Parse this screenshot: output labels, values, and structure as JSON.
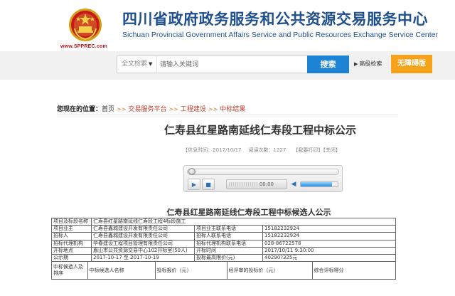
{
  "header": {
    "title_cn": "四川省政府政务服务和公共资源交易服务中心",
    "title_en": "Sichuan Provincial Government Affairs Service and Public Resources Exchange Service Center",
    "url": "www.SPPREC.com",
    "emblem_icon": "national-emblem-icon"
  },
  "search": {
    "scope_label": "全文检索",
    "scope_arrow": "▼",
    "placeholder": "请输入关键词",
    "button_label": "搜索",
    "advanced_label": "高级检索",
    "no_process_label": "无障碍版"
  },
  "breadcrumb": {
    "prefix": "您现在的位置：",
    "home": "首页",
    "sep": ">>",
    "items": [
      "交易服务平台",
      "工程建设",
      "中标结果"
    ]
  },
  "article": {
    "title": "仁寿县红星路南延线仁寿段工程中标公示",
    "meta_info_time": "【信息时间：2017/10/17",
    "meta_views": "阅读次数：1227",
    "meta_print": "【我要打印】【关闭】"
  },
  "player": {
    "time": "00:00",
    "play_icon": "play-icon",
    "stop_icon": "stop-icon",
    "volume_icon": "volume-icon",
    "progress_fraction": 0.0,
    "volume_fraction": 0.85
  },
  "table": {
    "title": "仁寿县红星路南延线仁寿段工程中标候选人公示",
    "rows": [
      [
        "项目及标段名称",
        "仁寿县红星路南延线仁寿段工程4标段施工",
        "",
        ""
      ],
      [
        "项目业主",
        "仁寿县鑫城建设开发有限责任公司",
        "项目业主联系电话",
        "15182232924"
      ],
      [
        "招标人",
        "仁寿县鑫城建设开发有限责任公司",
        "招标人联系电话",
        "15182232924"
      ],
      [
        "招标代理机构",
        "华春建设工程项目管理有限责任公司",
        "招标代理机构联系电话",
        "028-86722578"
      ],
      [
        "开标地点",
        "眉山市公共资源交易中心102开标室(50人)",
        "开标时间",
        "2017/10/11 9:30:00"
      ],
      [
        "公示期",
        "2017-10-17 至 2017-10-19",
        "投标最高限价(元)",
        "40290?325元"
      ]
    ],
    "header_row": [
      "中标候选人及排序",
      "中标候选人名称",
      "投标报价（元）",
      "经评审的投标价（元）",
      "综合评标得分"
    ]
  },
  "colors": {
    "brand_blue": "#1f4f8f",
    "search_blue": "#1d83d4",
    "accent_orange": "#f7a21b",
    "link_red": "#c0392b"
  }
}
